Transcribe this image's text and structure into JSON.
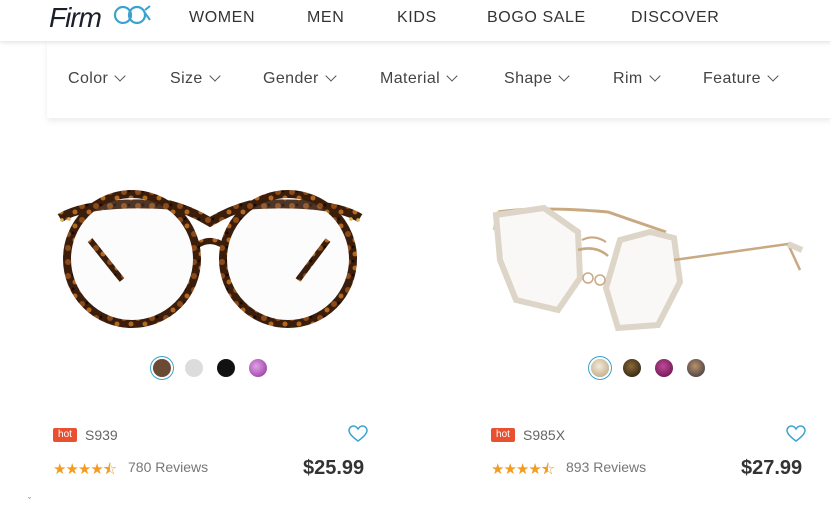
{
  "brand": {
    "logo_text": "Firm",
    "logo_suffix": "oo",
    "accent": "#3aa2cf"
  },
  "nav": {
    "items": [
      "WOMEN",
      "MEN",
      "KIDS",
      "BOGO SALE",
      "DISCOVER"
    ]
  },
  "filters": {
    "items": [
      "Color",
      "Size",
      "Gender",
      "Material",
      "Shape",
      "Rim",
      "Feature"
    ]
  },
  "products": [
    {
      "badge": "hot",
      "sku": "S939",
      "rating": 4.5,
      "stars": "★★★★⯪",
      "reviews": "780 Reviews",
      "price": "$25.99",
      "swatches": [
        "#6b4a33",
        "#dcdcdc",
        "#111111",
        "#a44bb0"
      ],
      "selected_swatch": 0,
      "frame_style": "tortoise-round"
    },
    {
      "badge": "hot",
      "sku": "S985X",
      "rating": 4.5,
      "stars": "★★★★⯪",
      "reviews": "893 Reviews",
      "price": "$27.99",
      "swatches": [
        "#cbb89a",
        "#3a2a14",
        "#7a1d5a",
        "#4c4a58"
      ],
      "selected_swatch": 0,
      "frame_style": "clear-geometric"
    }
  ],
  "colors": {
    "hot_badge": "#e8502f",
    "star": "#f39c1f",
    "heart": "#3aa2cf"
  }
}
